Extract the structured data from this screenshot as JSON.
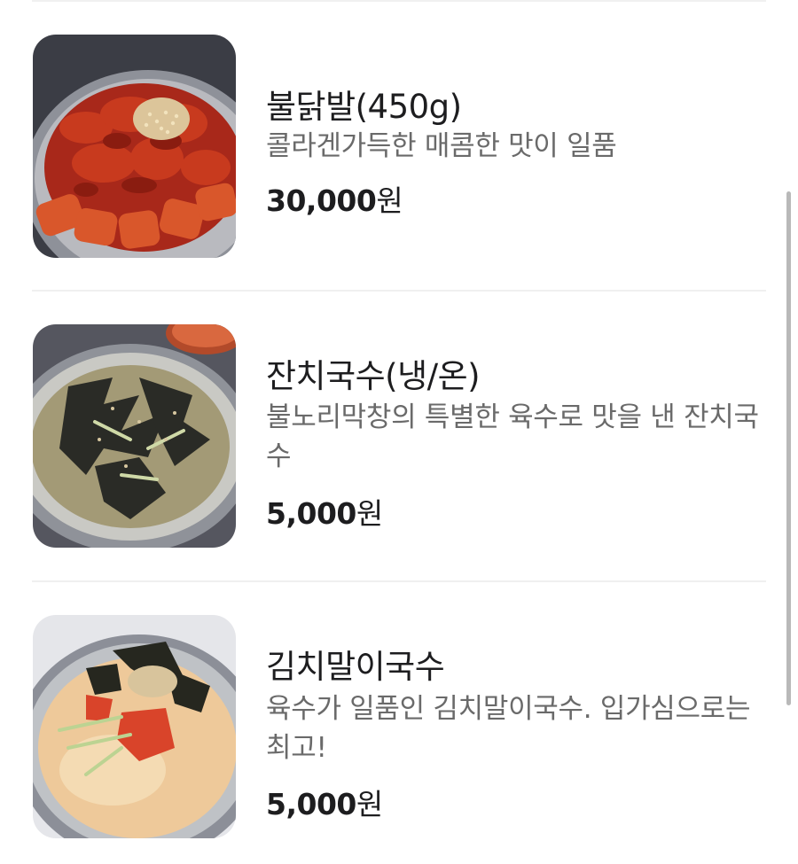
{
  "menu": {
    "items": [
      {
        "name": "불닭발(450g)",
        "description": "콜라겐가득한 매콤한 맛이 일품",
        "price": "30,000",
        "currency": "원",
        "image": "spicy-chicken-feet-photo"
      },
      {
        "name": "잔치국수(냉/온)",
        "description": "불노리막창의 특별한 육수로 맛을 낸 잔치국수",
        "price": "5,000",
        "currency": "원",
        "image": "banquet-noodles-photo"
      },
      {
        "name": "김치말이국수",
        "description": "육수가 일품인 김치말이국수. 입가심으로는 최고!",
        "price": "5,000",
        "currency": "원",
        "image": "kimchi-noodles-photo"
      }
    ]
  },
  "colors": {
    "title": "#1d1d1f",
    "description": "#6a6a6a",
    "divider": "#f0f0f0",
    "scrollbar": "#b9b9b9"
  }
}
